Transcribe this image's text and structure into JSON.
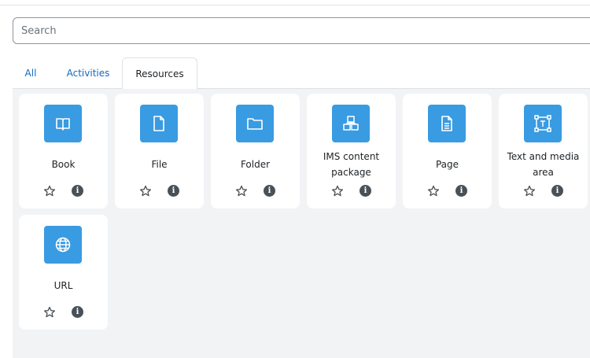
{
  "search": {
    "placeholder": "Search",
    "value": ""
  },
  "tabs": [
    {
      "label": "All",
      "active": false
    },
    {
      "label": "Activities",
      "active": false
    },
    {
      "label": "Resources",
      "active": true
    }
  ],
  "modules": [
    {
      "label": "Book",
      "icon": "book-icon"
    },
    {
      "label": "File",
      "icon": "file-icon"
    },
    {
      "label": "Folder",
      "icon": "folder-icon"
    },
    {
      "label": "IMS content package",
      "icon": "package-icon"
    },
    {
      "label": "Page",
      "icon": "page-icon"
    },
    {
      "label": "Text and media area",
      "icon": "text-media-icon"
    },
    {
      "label": "URL",
      "icon": "globe-icon"
    }
  ],
  "colors": {
    "accent": "#399be2",
    "link": "#0f6cbf",
    "panel_bg": "#f1f3f5",
    "info_badge": "#495057"
  }
}
